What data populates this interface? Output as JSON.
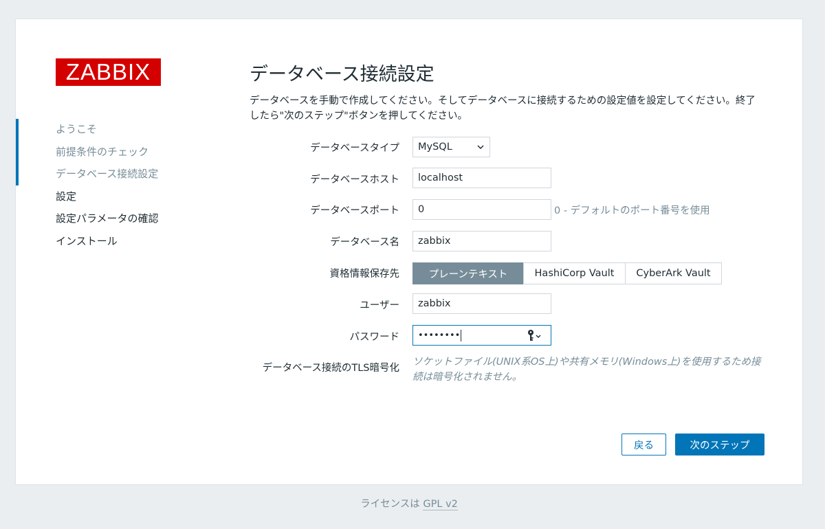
{
  "brand": {
    "logo_text": "ZABBIX",
    "color": "#d40000"
  },
  "steps": [
    {
      "label": "ようこそ",
      "state": "done"
    },
    {
      "label": "前提条件のチェック",
      "state": "done"
    },
    {
      "label": "データベース接続設定",
      "state": "current"
    },
    {
      "label": "設定",
      "state": "todo"
    },
    {
      "label": "設定パラメータの確認",
      "state": "todo"
    },
    {
      "label": "インストール",
      "state": "todo"
    }
  ],
  "page": {
    "title": "データベース接続設定",
    "description": "データベースを手動で作成してください。そしてデータベースに接続するための設定値を設定してください。終了したら\"次のステップ\"ボタンを押してください。"
  },
  "form": {
    "db_type": {
      "label": "データベースタイプ",
      "value": "MySQL"
    },
    "db_host": {
      "label": "データベースホスト",
      "value": "localhost"
    },
    "db_port": {
      "label": "データベースポート",
      "value": "0",
      "hint": "0 - デフォルトのポート番号を使用"
    },
    "db_name": {
      "label": "データベース名",
      "value": "zabbix"
    },
    "credential_store": {
      "label": "資格情報保存先",
      "options": [
        "プレーンテキスト",
        "HashiCorp Vault",
        "CyberArk Vault"
      ],
      "selected": "プレーンテキスト"
    },
    "user": {
      "label": "ユーザー",
      "value": "zabbix"
    },
    "password": {
      "label": "パスワード",
      "masked_value": "••••••••"
    },
    "tls": {
      "label": "データベース接続のTLS暗号化",
      "note": "ソケットファイル(UNIX系OS上)や共有メモリ(Windows上)を使用するため接続は暗号化されません。"
    }
  },
  "buttons": {
    "back": "戻る",
    "next": "次のステップ"
  },
  "footer": {
    "prefix": "ライセンスは",
    "link": "GPL v2"
  },
  "colors": {
    "accent": "#0275b8",
    "muted": "#768d99",
    "text": "#1f2c33"
  }
}
